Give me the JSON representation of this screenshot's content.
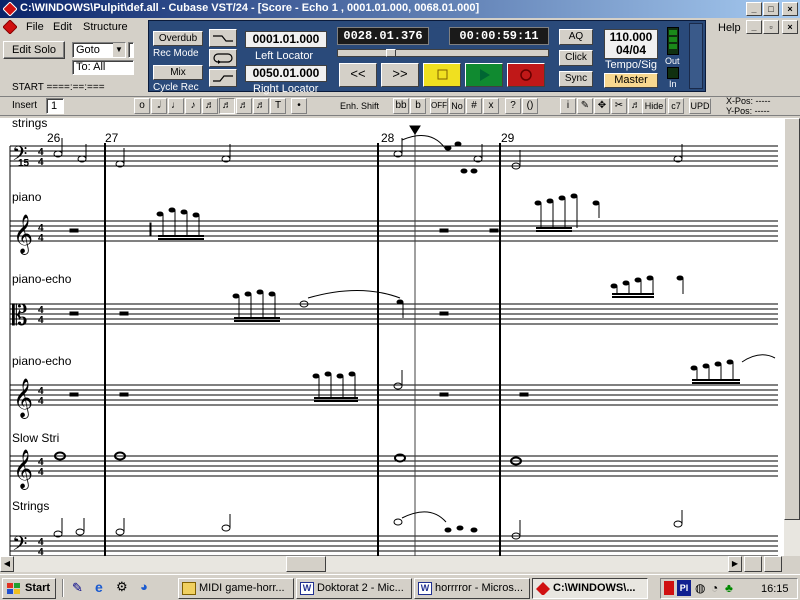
{
  "window": {
    "title": "C:\\WINDOWS\\Pulpit\\def.all - Cubase VST/24 - [Score - Echo 1   , 0001.01.000, 0068.01.000]"
  },
  "menu": {
    "file": "File",
    "edit": "Edit",
    "structure": "Structure",
    "help": "Help"
  },
  "left_panel": {
    "edit_solo": "Edit Solo",
    "goto": "Goto",
    "to_all": "To: All",
    "start": "START ====:==:==="
  },
  "transport": {
    "overdub": "Overdub",
    "rec_mode": "Rec Mode",
    "mix": "Mix",
    "cycle_rec": "Cycle Rec",
    "left_locator_value": "0001.01.000",
    "left_locator_label": "Left Locator",
    "right_locator_value": "0050.01.000",
    "right_locator_label": "Right Locator",
    "position_bars": "0028.01.376",
    "position_time": "00:00:59:11",
    "aq": "AQ",
    "click": "Click",
    "sync": "Sync",
    "tempo": "110.000",
    "signature": "04/04",
    "tempo_sig_label": "Tempo/Sig",
    "master": "Master",
    "out": "Out",
    "in": "In",
    "rewind": "<<",
    "forward": ">>"
  },
  "score_toolbar": {
    "insert_label": "Insert",
    "insert_value": "1",
    "enh_shift": "Enh. Shift",
    "off": "OFF",
    "no": "No",
    "hide": "Hide",
    "upd": "UPD",
    "x_pos": "X-Pos: -----",
    "y_pos": "Y-Pos: -----",
    "accidentals": [
      "bb",
      "b",
      "♮",
      "#",
      "x",
      "?",
      "()"
    ]
  },
  "score": {
    "measures": [
      "26",
      "27",
      "28",
      "29"
    ],
    "tracks": [
      "strings",
      "piano",
      "piano-echo",
      "piano-echo",
      "Slow Stri",
      "Strings"
    ],
    "clef_bottom_number": "15",
    "time_sig": "4/4"
  },
  "taskbar": {
    "start": "Start",
    "tasks": [
      "MIDI game-horr...",
      "Doktorat 2 - Mic...",
      "horrrror - Micros...",
      "C:\\WINDOWS\\..."
    ],
    "tray_text": "Pl",
    "clock": "16:15"
  }
}
